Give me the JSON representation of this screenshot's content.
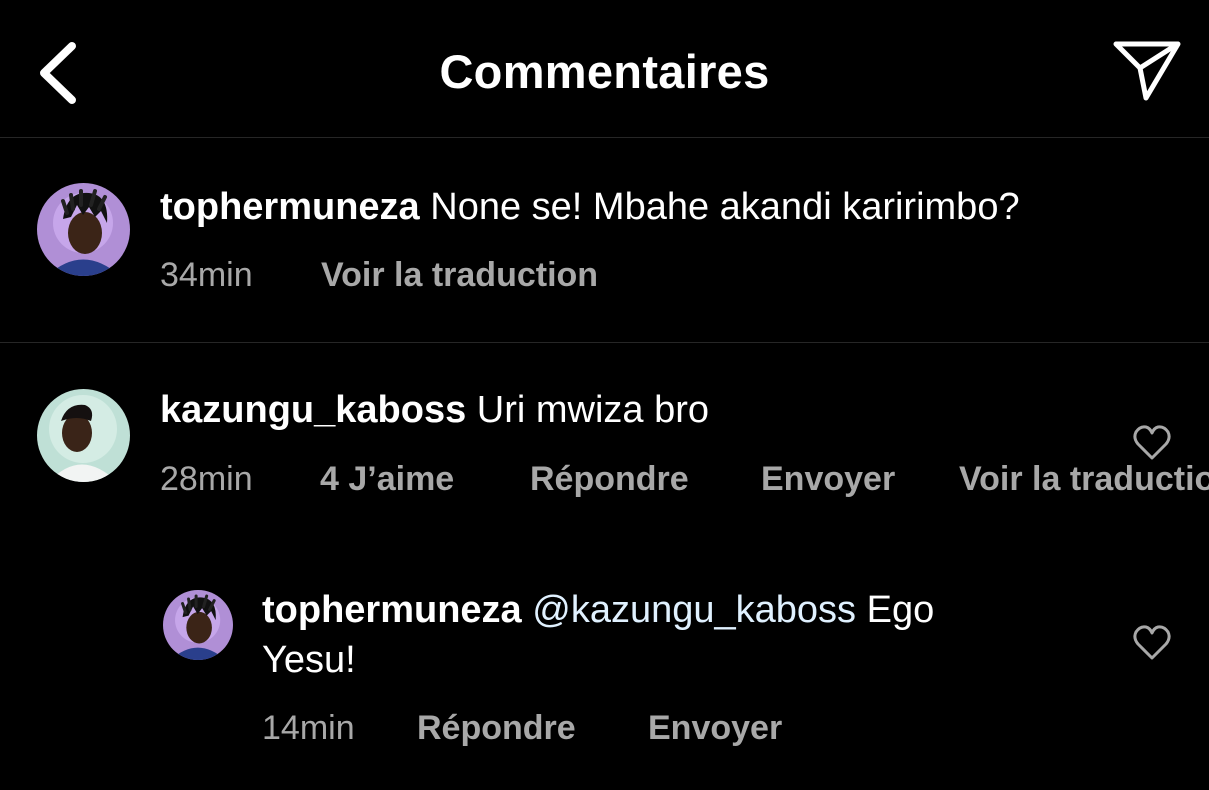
{
  "header": {
    "title": "Commentaires"
  },
  "colors": {
    "background": "#000000",
    "text": "#ffffff",
    "secondary_text": "#a8a8a8",
    "divider": "#262626",
    "mention": "#e0f1ff"
  },
  "caption": {
    "username": "tophermuneza",
    "text": "None se! Mbahe akandi karirimbo?",
    "time": "34min",
    "translate_label": "Voir la traduction"
  },
  "comment": {
    "username": "kazungu_kaboss",
    "text": "Uri mwiza bro",
    "time": "28min",
    "likes_label": "4 J’aime",
    "reply_label": "Répondre",
    "send_label": "Envoyer",
    "translate_label": "Voir la traduction"
  },
  "reply": {
    "username": "tophermuneza",
    "mention": "@kazungu_kaboss",
    "text_line1_suffix": "Ego",
    "text_line2": "Yesu!",
    "time": "14min",
    "reply_label": "Répondre",
    "send_label": "Envoyer"
  },
  "icons": {
    "back": "chevron-left-icon",
    "send": "paper-plane-icon",
    "like": "heart-outline-icon"
  }
}
